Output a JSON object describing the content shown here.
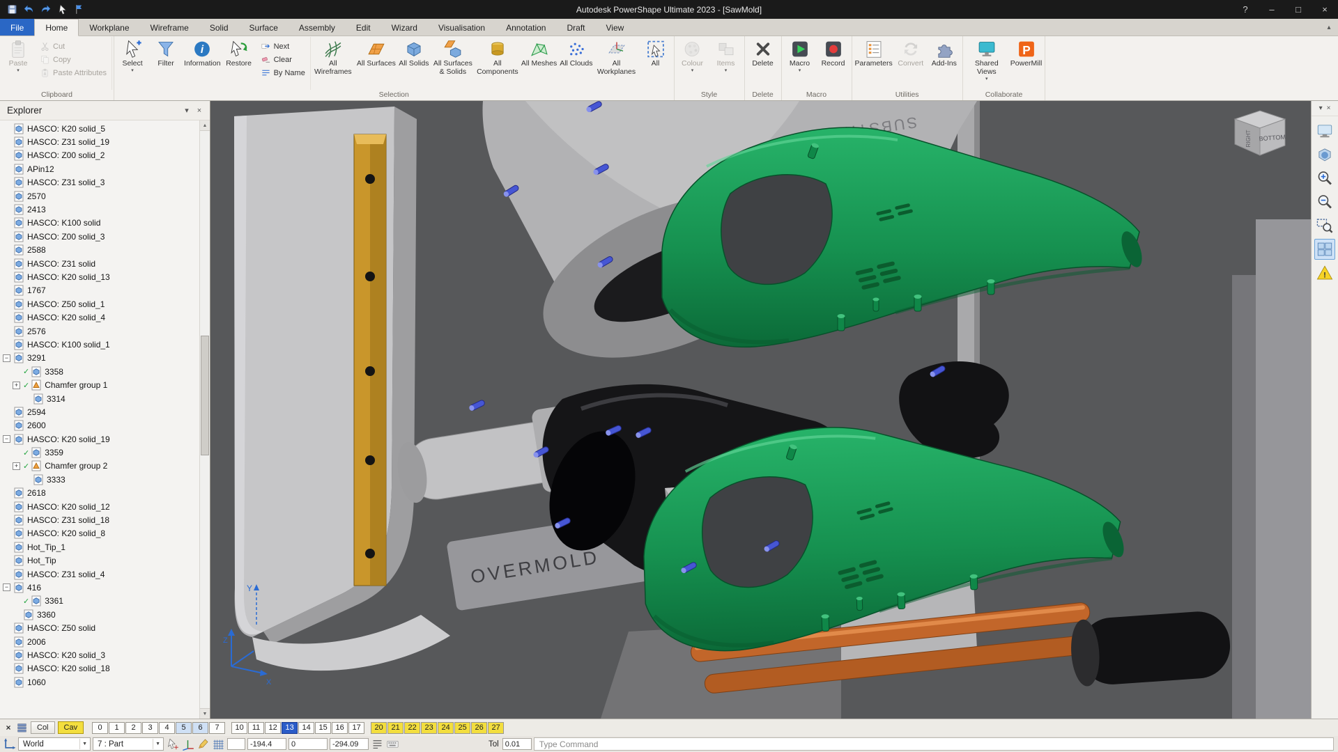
{
  "window": {
    "title": "Autodesk PowerShape Ultimate 2023 - [SawMold]",
    "quick_access": [
      "save",
      "undo",
      "redo",
      "select-tool",
      "flag"
    ],
    "controls": {
      "help": "?",
      "minimize": "–",
      "maximize": "□",
      "close": "×"
    }
  },
  "tabs": {
    "active": "Home",
    "items": [
      "File",
      "Home",
      "Workplane",
      "Wireframe",
      "Solid",
      "Surface",
      "Assembly",
      "Edit",
      "Wizard",
      "Visualisation",
      "Annotation",
      "Draft",
      "View"
    ]
  },
  "ribbon": {
    "groups": [
      {
        "label": "Clipboard",
        "items": [
          {
            "kind": "big",
            "label": "Paste",
            "icon": "paste",
            "enabled": false,
            "arrow": true
          },
          {
            "kind": "stack",
            "items": [
              {
                "label": "Cut",
                "icon": "cut",
                "enabled": false
              },
              {
                "label": "Copy",
                "icon": "copy",
                "enabled": false
              },
              {
                "label": "Paste Attributes",
                "icon": "paste-attributes",
                "enabled": false
              }
            ]
          }
        ]
      },
      {
        "label": "Selection",
        "items": [
          {
            "kind": "big",
            "label": "Select",
            "icon": "select",
            "arrow": true
          },
          {
            "kind": "big",
            "label": "Filter",
            "icon": "filter"
          },
          {
            "kind": "big",
            "label": "Information",
            "icon": "information"
          },
          {
            "kind": "big",
            "label": "Restore",
            "icon": "restore"
          },
          {
            "kind": "stack",
            "items": [
              {
                "label": "Next",
                "icon": "next"
              },
              {
                "label": "Clear",
                "icon": "clear"
              },
              {
                "label": "By Name",
                "icon": "by-name"
              }
            ]
          },
          {
            "kind": "big",
            "label": "All Wireframes",
            "icon": "all-wireframes"
          },
          {
            "kind": "big",
            "label": "All Surfaces",
            "icon": "all-surfaces"
          },
          {
            "kind": "big",
            "label": "All Solids",
            "icon": "all-solids"
          },
          {
            "kind": "big",
            "label": "All Surfaces & Solids",
            "icon": "all-surfaces-solids"
          },
          {
            "kind": "big",
            "label": "All Components",
            "icon": "all-components"
          },
          {
            "kind": "big",
            "label": "All Meshes",
            "icon": "all-meshes"
          },
          {
            "kind": "big",
            "label": "All Clouds",
            "icon": "all-clouds"
          },
          {
            "kind": "big",
            "label": "All Workplanes",
            "icon": "all-workplanes"
          },
          {
            "kind": "big",
            "label": "All",
            "icon": "all"
          }
        ]
      },
      {
        "label": "Style",
        "items": [
          {
            "kind": "big",
            "label": "Colour",
            "icon": "colour",
            "enabled": false,
            "arrow": true
          },
          {
            "kind": "big",
            "label": "Items",
            "icon": "items",
            "enabled": false,
            "arrow": true
          }
        ]
      },
      {
        "label": "Delete",
        "items": [
          {
            "kind": "big",
            "label": "Delete",
            "icon": "delete"
          }
        ]
      },
      {
        "label": "Macro",
        "items": [
          {
            "kind": "big",
            "label": "Macro",
            "icon": "macro",
            "arrow": true
          },
          {
            "kind": "big",
            "label": "Record",
            "icon": "record"
          }
        ]
      },
      {
        "label": "Utilities",
        "items": [
          {
            "kind": "big",
            "label": "Parameters",
            "icon": "parameters"
          },
          {
            "kind": "big",
            "label": "Convert",
            "icon": "convert",
            "enabled": false
          },
          {
            "kind": "big",
            "label": "Add-Ins",
            "icon": "add-ins"
          }
        ]
      },
      {
        "label": "Collaborate",
        "items": [
          {
            "kind": "big",
            "label": "Shared Views",
            "icon": "shared-views",
            "arrow": true
          },
          {
            "kind": "big",
            "label": "PowerMill",
            "icon": "powermill"
          }
        ]
      }
    ]
  },
  "explorer": {
    "title": "Explorer",
    "items": [
      {
        "label": "HASCO: K20 solid_5",
        "indent": 1,
        "icon": "solid"
      },
      {
        "label": "HASCO: Z31 solid_19",
        "indent": 1,
        "icon": "solid"
      },
      {
        "label": "HASCO: Z00 solid_2",
        "indent": 1,
        "icon": "solid"
      },
      {
        "label": "APin12",
        "indent": 1,
        "icon": "solid"
      },
      {
        "label": "HASCO: Z31 solid_3",
        "indent": 1,
        "icon": "solid"
      },
      {
        "label": "2570",
        "indent": 1,
        "icon": "solid"
      },
      {
        "label": "2413",
        "indent": 1,
        "icon": "solid"
      },
      {
        "label": "HASCO: K100 solid",
        "indent": 1,
        "icon": "solid"
      },
      {
        "label": "HASCO: Z00 solid_3",
        "indent": 1,
        "icon": "solid"
      },
      {
        "label": "2588",
        "indent": 1,
        "icon": "solid"
      },
      {
        "label": "HASCO: Z31 solid",
        "indent": 1,
        "icon": "solid"
      },
      {
        "label": "HASCO: K20 solid_13",
        "indent": 1,
        "icon": "solid"
      },
      {
        "label": "1767",
        "indent": 1,
        "icon": "solid"
      },
      {
        "label": "HASCO: Z50 solid_1",
        "indent": 1,
        "icon": "solid"
      },
      {
        "label": "HASCO: K20 solid_4",
        "indent": 1,
        "icon": "solid"
      },
      {
        "label": "2576",
        "indent": 1,
        "icon": "solid"
      },
      {
        "label": "HASCO: K100 solid_1",
        "indent": 1,
        "icon": "solid"
      },
      {
        "label": "3291",
        "indent": 1,
        "icon": "solid",
        "expander": "minus"
      },
      {
        "label": "3358",
        "indent": 2,
        "icon": "solid",
        "checked": true
      },
      {
        "label": "Chamfer group 1",
        "indent": 2,
        "icon": "chamfer",
        "checked": true,
        "expander": "plus"
      },
      {
        "label": "3314",
        "indent": 3,
        "icon": "solid"
      },
      {
        "label": "2594",
        "indent": 1,
        "icon": "solid"
      },
      {
        "label": "2600",
        "indent": 1,
        "icon": "solid"
      },
      {
        "label": "HASCO: K20 solid_19",
        "indent": 1,
        "icon": "solid",
        "expander": "minus"
      },
      {
        "label": "3359",
        "indent": 2,
        "icon": "solid",
        "checked": true
      },
      {
        "label": "Chamfer group 2",
        "indent": 2,
        "icon": "chamfer",
        "checked": true,
        "expander": "plus"
      },
      {
        "label": "3333",
        "indent": 3,
        "icon": "solid"
      },
      {
        "label": "2618",
        "indent": 1,
        "icon": "solid"
      },
      {
        "label": "HASCO: K20 solid_12",
        "indent": 1,
        "icon": "solid"
      },
      {
        "label": "HASCO: Z31 solid_18",
        "indent": 1,
        "icon": "solid"
      },
      {
        "label": "HASCO: K20 solid_8",
        "indent": 1,
        "icon": "solid"
      },
      {
        "label": "Hot_Tip_1",
        "indent": 1,
        "icon": "solid"
      },
      {
        "label": "Hot_Tip",
        "indent": 1,
        "icon": "solid"
      },
      {
        "label": "HASCO: Z31 solid_4",
        "indent": 1,
        "icon": "solid"
      },
      {
        "label": "416",
        "indent": 1,
        "icon": "solid",
        "expander": "minus"
      },
      {
        "label": "3361",
        "indent": 2,
        "icon": "solid",
        "checked": true
      },
      {
        "label": "3360",
        "indent": 2,
        "icon": "solid"
      },
      {
        "label": "HASCO: Z50 solid",
        "indent": 1,
        "icon": "solid"
      },
      {
        "label": "2006",
        "indent": 1,
        "icon": "solid"
      },
      {
        "label": "HASCO: K20 solid_3",
        "indent": 1,
        "icon": "solid"
      },
      {
        "label": "HASCO: K20 solid_18",
        "indent": 1,
        "icon": "solid"
      },
      {
        "label": "1060",
        "indent": 1,
        "icon": "solid"
      }
    ]
  },
  "viewport": {
    "labels": {
      "overmold": "OVERMOLD",
      "substrate": "SUBSTRATE"
    },
    "viewcube": {
      "front": "BOTTOM",
      "side": "RIGHT"
    },
    "axis_labels": {
      "x": "X",
      "y": "Y",
      "z": "Z"
    }
  },
  "right_toolbar": [
    {
      "name": "screen"
    },
    {
      "name": "render-style"
    },
    {
      "name": "zoom-in"
    },
    {
      "name": "zoom-out"
    },
    {
      "name": "zoom-box"
    },
    {
      "name": "multi-view",
      "active": true
    },
    {
      "name": "warning"
    }
  ],
  "level_bar": {
    "col_label": "Col",
    "cav_label": "Cav",
    "numbers": [
      {
        "n": "0"
      },
      {
        "n": "1"
      },
      {
        "n": "2"
      },
      {
        "n": "3"
      },
      {
        "n": "4"
      },
      {
        "n": "5",
        "state": "blue"
      },
      {
        "n": "6",
        "state": "blue"
      },
      {
        "n": "7"
      },
      {
        "n": "10",
        "gap": true
      },
      {
        "n": "11"
      },
      {
        "n": "12"
      },
      {
        "n": "13",
        "state": "selected"
      },
      {
        "n": "14"
      },
      {
        "n": "15"
      },
      {
        "n": "16"
      },
      {
        "n": "17"
      },
      {
        "n": "20",
        "gap": true,
        "state": "yellow"
      },
      {
        "n": "21",
        "state": "yellow"
      },
      {
        "n": "22",
        "state": "yellow"
      },
      {
        "n": "23",
        "state": "yellow"
      },
      {
        "n": "24",
        "state": "yellow"
      },
      {
        "n": "25",
        "state": "yellow"
      },
      {
        "n": "26",
        "state": "yellow"
      },
      {
        "n": "27",
        "state": "yellow"
      }
    ]
  },
  "command_bar": {
    "world_label": "World",
    "part_label": "7 : Part",
    "coord_values": [
      "-194.4",
      "0",
      "-294.09"
    ],
    "tol_label": "Tol",
    "tol_value": "0.01",
    "command_placeholder": "Type Command"
  },
  "ui_glyphs": {
    "caret": "▼",
    "menu": "▾",
    "close": "×",
    "collapse": "▴",
    "scroll_up": "▲",
    "scroll_down": "▼"
  }
}
